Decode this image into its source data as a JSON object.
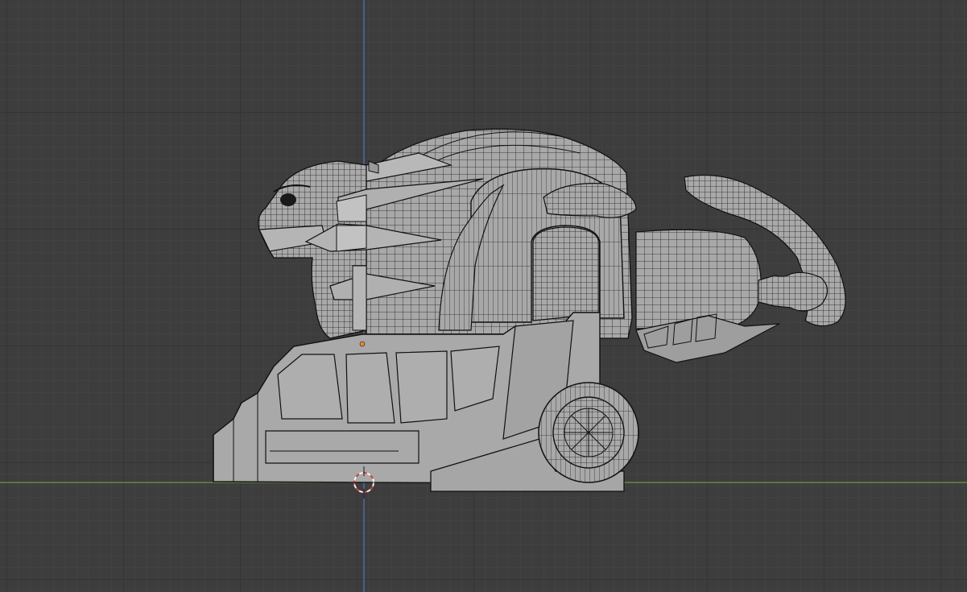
{
  "viewport": {
    "view": "orthographic-side",
    "shading": "wireframe-overlay",
    "colors": {
      "background": "#3d3d3d",
      "grid_minor": "#474747",
      "grid_major": "#333333",
      "x_axis": "#6f9a3c",
      "z_axis": "#4d73b8",
      "mesh_fill": "#a8a8a8",
      "mesh_wire": "#1a1a1a",
      "cursor_red": "#c94343",
      "cursor_white": "#f2f2f2",
      "origin_point": "#e08a33"
    },
    "objects": [
      {
        "name": "lion-head",
        "icon": "mesh-object"
      },
      {
        "name": "lion-body",
        "icon": "mesh-object"
      },
      {
        "name": "lion-tail",
        "icon": "mesh-object"
      },
      {
        "name": "tank-base",
        "icon": "mesh-object"
      },
      {
        "name": "wheel",
        "icon": "mesh-object"
      }
    ],
    "cursor": {
      "icon": "3d-cursor-icon"
    },
    "origin": {
      "icon": "origin-dot-icon"
    }
  }
}
